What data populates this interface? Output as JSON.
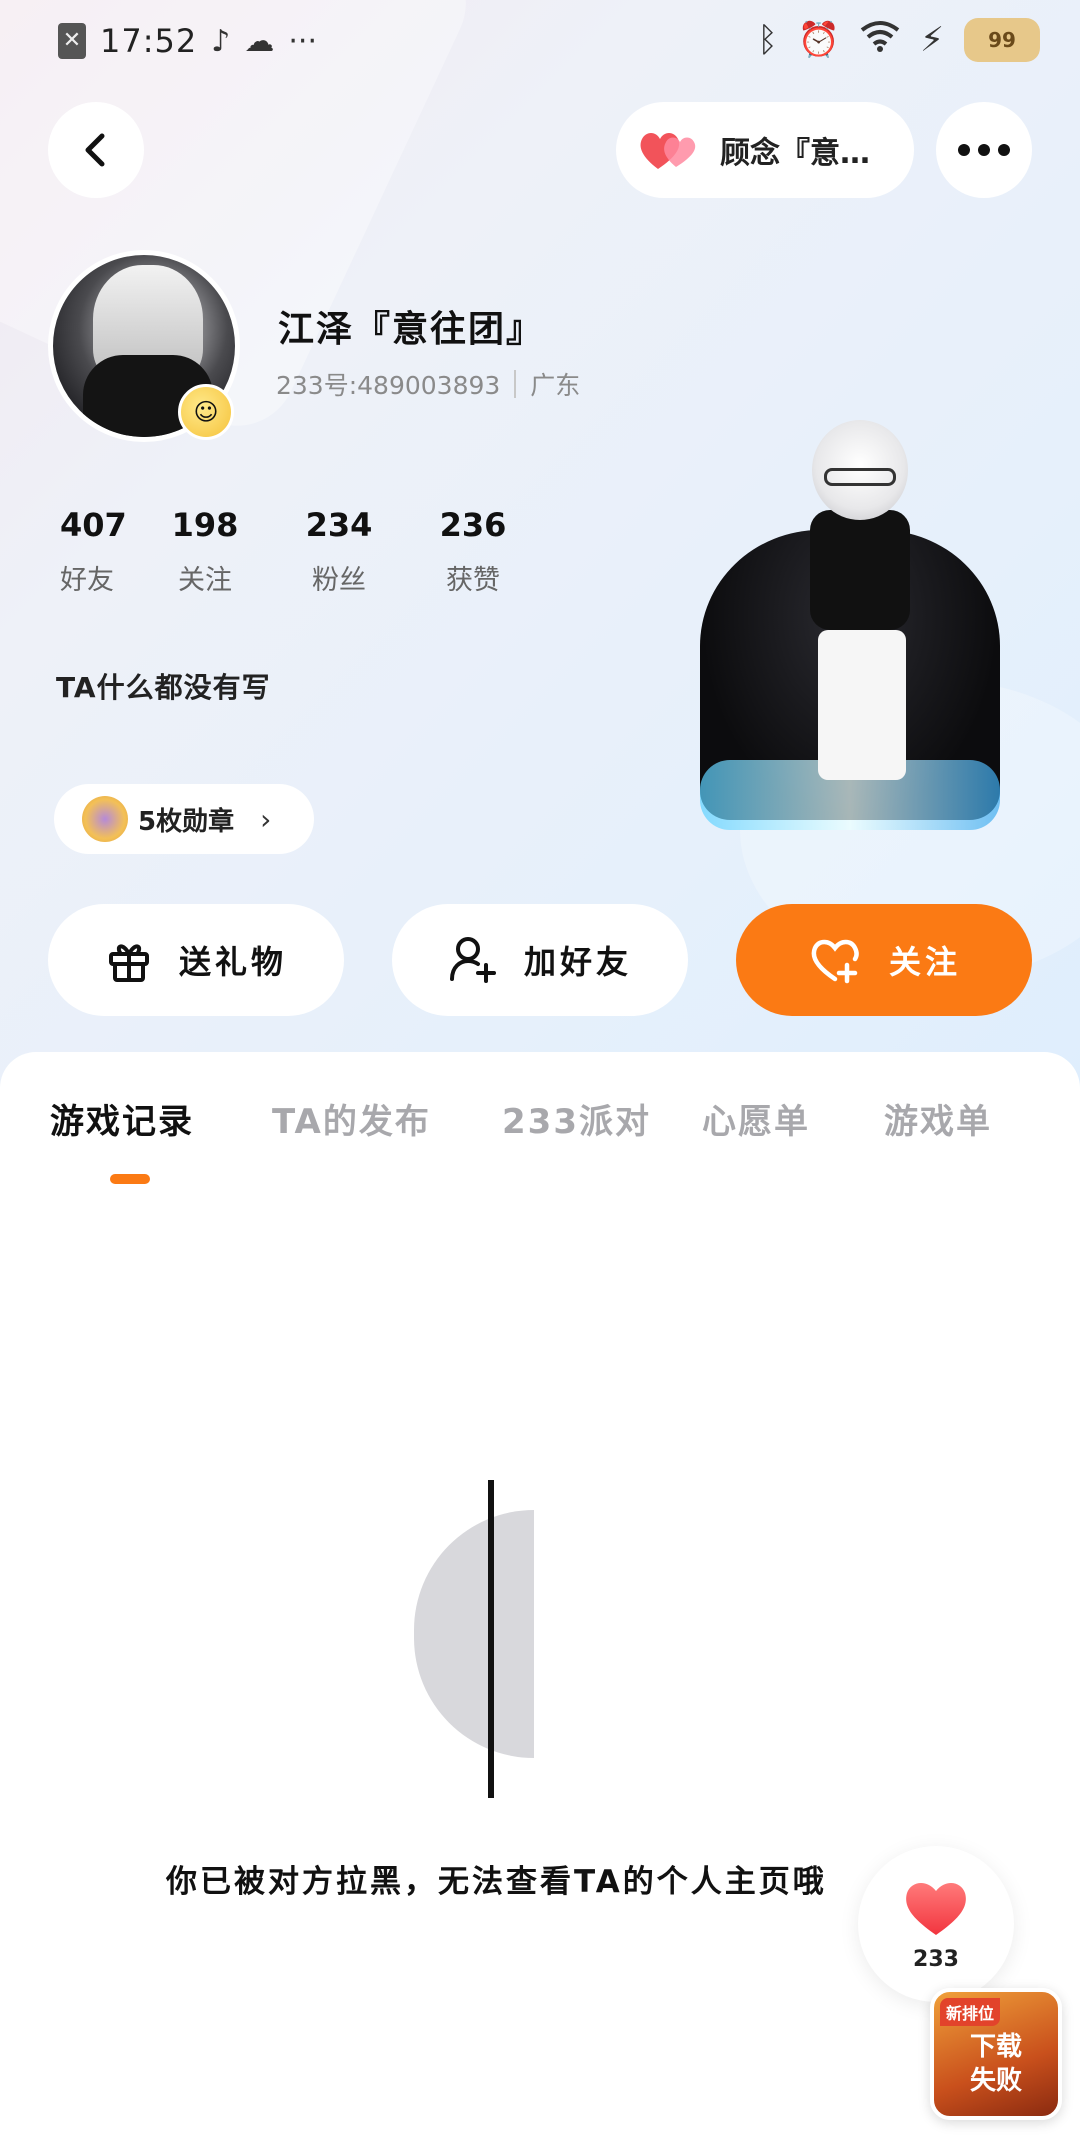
{
  "status_bar": {
    "time": "17:52",
    "battery_label": "99",
    "icons": [
      "sim-icon",
      "music-icon",
      "cloud-icon",
      "more-dots-icon",
      "bluetooth-icon",
      "alarm-icon",
      "wifi-icon",
      "charging-icon",
      "battery-icon"
    ]
  },
  "header": {
    "friend_name": "顾念『意…"
  },
  "profile": {
    "username": "江泽『意往团』",
    "user_id": "233号:489003893",
    "location": "广东",
    "bio": "TA什么都没有写",
    "medals_label": "5枚勋章"
  },
  "stats": [
    {
      "value": "407",
      "label": "好友"
    },
    {
      "value": "198",
      "label": "关注"
    },
    {
      "value": "234",
      "label": "粉丝"
    },
    {
      "value": "236",
      "label": "获赞"
    }
  ],
  "actions": {
    "gift": "送礼物",
    "add_friend": "加好友",
    "follow": "关注"
  },
  "tabs": [
    {
      "label": "游戏记录",
      "active": true
    },
    {
      "label": "TA的发布",
      "active": false
    },
    {
      "label": "233派对",
      "active": false
    },
    {
      "label": "心愿单",
      "active": false
    },
    {
      "label": "游戏单",
      "active": false
    }
  ],
  "empty_state": {
    "message": "你已被对方拉黑，无法查看TA的个人主页哦"
  },
  "floating": {
    "like_count": "233",
    "download_tag": "新排位",
    "download_line1": "下载",
    "download_line2": "失败"
  },
  "colors": {
    "accent": "#fb7a14",
    "heart": "#f2535a"
  }
}
